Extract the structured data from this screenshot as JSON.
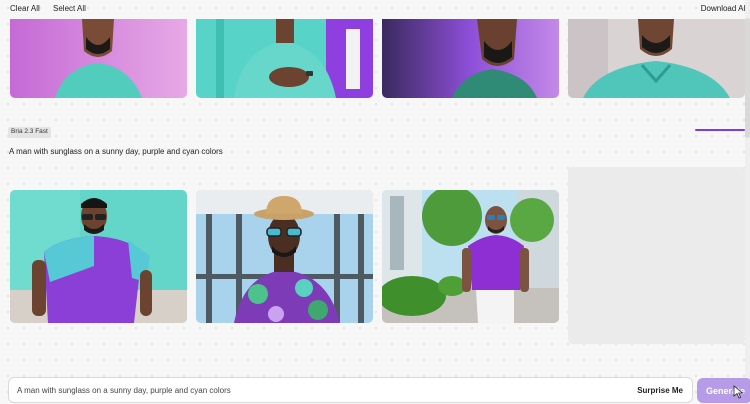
{
  "toolbar": {
    "clear_all": "Clear All",
    "select_all": "Select All",
    "download_all": "Download All"
  },
  "generation": {
    "model_badge": "Bria 2.3 Fast",
    "prompt": "A man with sunglass on a sunny day, purple and cyan colors"
  },
  "top_row_images": [
    {
      "name": "image-man-cyan-shirt-pink-bg"
    },
    {
      "name": "image-man-cyan-shirt-hands"
    },
    {
      "name": "image-man-purple-light-profile"
    },
    {
      "name": "image-man-cyan-polo"
    }
  ],
  "result_images": [
    {
      "name": "image-man-sunglasses-purple-cyan-tee"
    },
    {
      "name": "image-man-straw-hat-floral-shirt"
    },
    {
      "name": "image-man-purple-polo-street"
    }
  ],
  "prompt_bar": {
    "value": "A man with sunglass on a sunny day, purple and cyan colors",
    "surprise_label": "Surprise Me",
    "generate_label": "Generate"
  },
  "colors": {
    "accent": "#7c3aed",
    "generate_bg": "#b59be8",
    "cyan": "#5fd0c6",
    "purple": "#8b2fd8"
  }
}
